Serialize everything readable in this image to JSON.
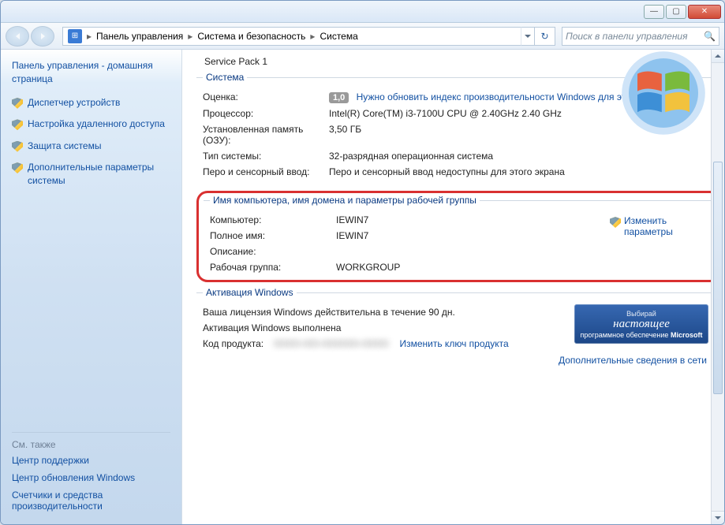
{
  "window": {
    "minimize": "—",
    "maximize": "▢",
    "close": "✕"
  },
  "nav": {
    "crumbs": [
      "Панель управления",
      "Система и безопасность",
      "Система"
    ],
    "search_placeholder": "Поиск в панели управления"
  },
  "sidebar": {
    "home": "Панель управления - домашняя страница",
    "links": [
      "Диспетчер устройств",
      "Настройка удаленного доступа",
      "Защита системы",
      "Дополнительные параметры системы"
    ],
    "also_heading": "См. также",
    "also": [
      "Центр поддержки",
      "Центр обновления Windows",
      "Счетчики и средства производительности"
    ]
  },
  "content": {
    "service_pack": "Service Pack 1",
    "system_legend": "Система",
    "rating_label": "Оценка:",
    "rating_value": "1,0",
    "rating_link": "Нужно обновить индекс производительности Windows для этого компьютера",
    "cpu_label": "Процессор:",
    "cpu_value": "Intel(R) Core(TM) i3-7100U CPU @ 2.40GHz   2.40 GHz",
    "ram_label": "Установленная память (ОЗУ):",
    "ram_value": "3,50 ГБ",
    "systype_label": "Тип системы:",
    "systype_value": "32-разрядная операционная система",
    "pen_label": "Перо и сенсорный ввод:",
    "pen_value": "Перо и сенсорный ввод недоступны для этого экрана",
    "domain_legend": "Имя компьютера, имя домена и параметры рабочей группы",
    "change_params": "Изменить параметры",
    "computer_label": "Компьютер:",
    "computer_value": "IEWIN7",
    "fullname_label": "Полное имя:",
    "fullname_value": "IEWIN7",
    "desc_label": "Описание:",
    "desc_value": "",
    "workgroup_label": "Рабочая группа:",
    "workgroup_value": "WORKGROUP",
    "activation_legend": "Активация Windows",
    "license_text": "Ваша лицензия Windows действительна в течение 90 дн.",
    "activated_text": "Активация Windows выполнена",
    "productid_label": "Код продукта:",
    "productid_value": "00000-000-0000000-00000",
    "change_key": "Изменить ключ продукта",
    "banner_l1": "Выбирай",
    "banner_l2": "настоящее",
    "banner_l3": "программное обеспечение",
    "banner_l4": "Microsoft",
    "morelink": "Дополнительные сведения в сети"
  }
}
